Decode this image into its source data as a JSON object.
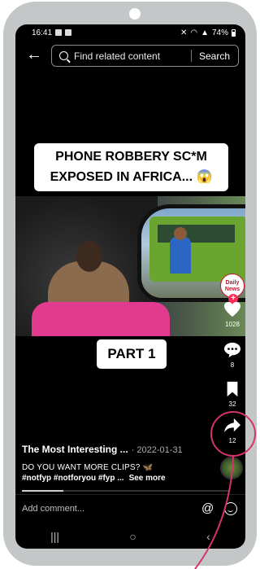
{
  "status_bar": {
    "time": "16:41",
    "battery": "74%"
  },
  "search": {
    "placeholder": "Find related content",
    "button": "Search"
  },
  "video": {
    "title_line1": "PHONE ROBBERY SC*M",
    "title_line2": "EXPOSED IN AFRICA... 😱",
    "badge_text_1": "Daily",
    "badge_text_2": "News",
    "part_label": "PART 1"
  },
  "actions": {
    "likes": "1028",
    "comments": "8",
    "saves": "32",
    "shares": "12"
  },
  "caption": {
    "author": "The Most Interesting ...",
    "date": "· 2022-01-31",
    "text": "DO YOU WANT MORE CLIPS? 🦋",
    "tags": "#notfyp #notforyou #fyp ...",
    "see_more": "See more"
  },
  "progress_fraction": 0.2,
  "comment_bar": {
    "placeholder": "Add comment..."
  },
  "colors": {
    "highlight": "#d6336c",
    "like_red": "#ff2b55"
  },
  "icons": [
    "back-arrow-icon",
    "search-icon",
    "heart-icon",
    "comment-icon",
    "bookmark-icon",
    "share-icon",
    "at-icon",
    "emoji-icon",
    "recents-icon",
    "home-icon",
    "back-nav-icon"
  ]
}
